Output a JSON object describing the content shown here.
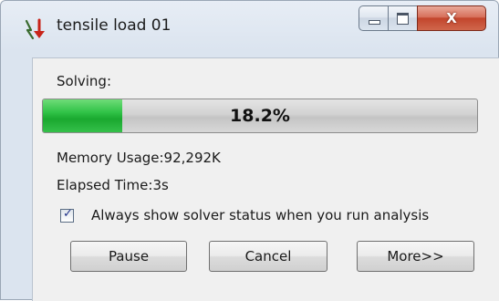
{
  "window": {
    "title": "tensile load 01",
    "title_icon": "solver-arrows-icon",
    "close_glyph": "X"
  },
  "progress": {
    "label": "Solving:",
    "value": 0.182,
    "text": "18.2%",
    "fill_color": "#2fc246"
  },
  "status": {
    "memory": "Memory Usage:92,292K",
    "elapsed": "Elapsed Time:3s"
  },
  "option": {
    "checked": true,
    "label": "Always show solver status when you run analysis"
  },
  "buttons": {
    "pause": "Pause",
    "cancel": "Cancel",
    "more": "More>>"
  }
}
